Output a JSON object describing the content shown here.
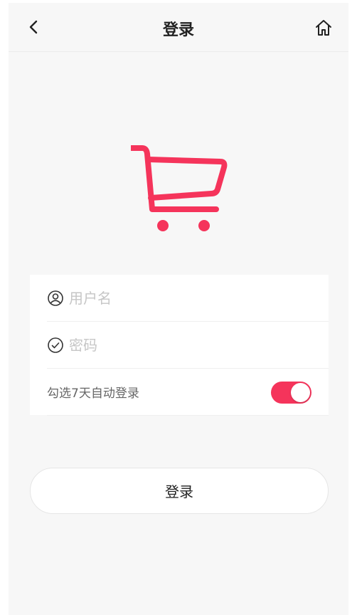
{
  "colors": {
    "accent": "#f5345b",
    "background": "#f7f7f7",
    "card": "#ffffff"
  },
  "navbar": {
    "title": "登录",
    "back_icon": "chevron-left-icon",
    "home_icon": "home-icon"
  },
  "logo": {
    "icon": "shopping-cart-icon"
  },
  "form": {
    "username": {
      "placeholder": "用户名",
      "value": "",
      "icon": "user-icon"
    },
    "password": {
      "placeholder": "密码",
      "value": "",
      "icon": "check-circle-icon"
    },
    "auto_login": {
      "label": "勾选7天自动登录",
      "enabled": true
    }
  },
  "login_button": {
    "label": "登录"
  }
}
